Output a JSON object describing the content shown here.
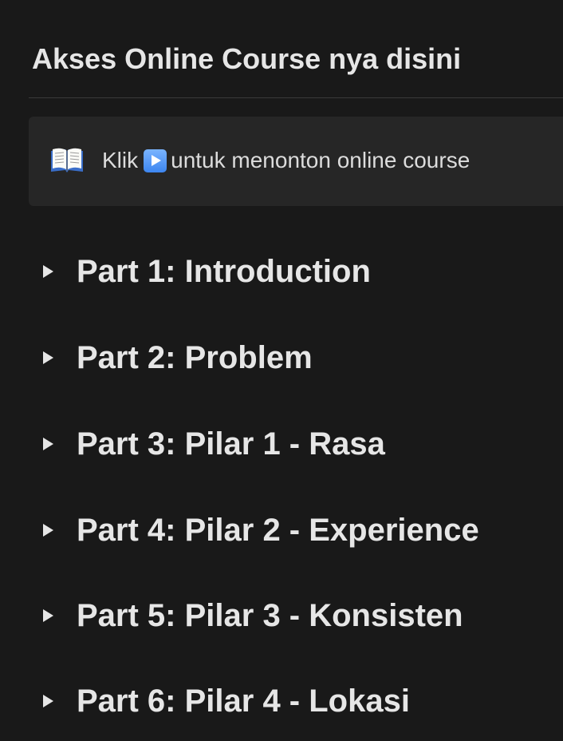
{
  "page": {
    "heading": "Akses Online Course nya disini"
  },
  "callout": {
    "icon": "open-book-icon",
    "text_before": "Klik",
    "inline_icon": "play-button-icon",
    "text_after": "untuk menonton online course"
  },
  "toggles": [
    {
      "label": "Part 1: Introduction"
    },
    {
      "label": "Part 2: Problem"
    },
    {
      "label": "Part 3: Pilar 1 - Rasa"
    },
    {
      "label": "Part 4: Pilar 2 - Experience"
    },
    {
      "label": "Part 5: Pilar 3 - Konsisten"
    },
    {
      "label": "Part 6: Pilar 4 - Lokasi"
    }
  ]
}
